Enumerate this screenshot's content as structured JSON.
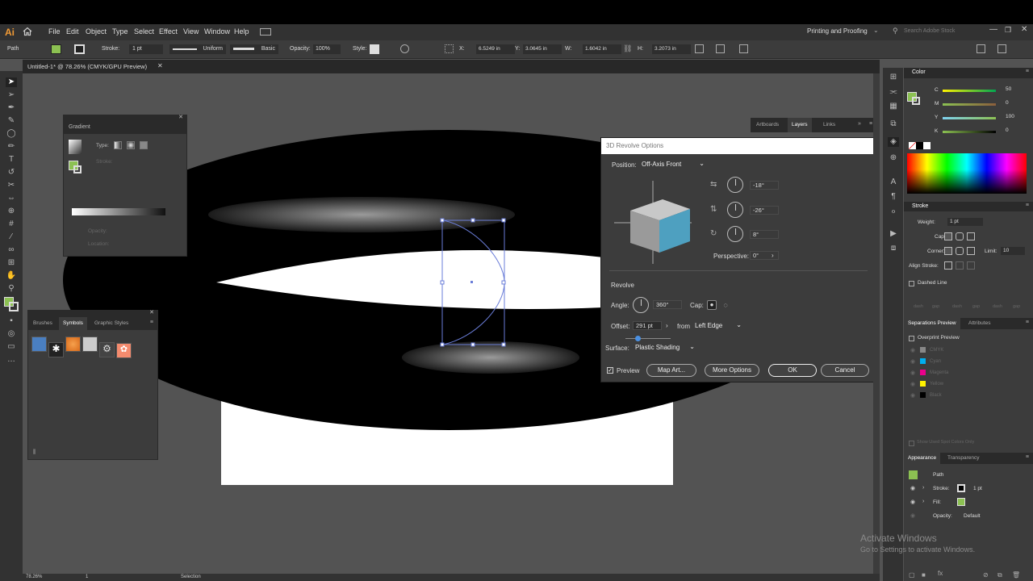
{
  "app_logo": "Ai",
  "menu": [
    "File",
    "Edit",
    "Object",
    "Type",
    "Select",
    "Effect",
    "View",
    "Window",
    "Help"
  ],
  "workspace": "Printing and Proofing",
  "search_placeholder": "Search Adobe Stock",
  "control": {
    "selection_type": "Path",
    "stroke_label": "Stroke:",
    "stroke_value": "1 pt",
    "profile": "Uniform",
    "brush": "Basic",
    "opacity_label": "Opacity:",
    "opacity_value": "100%",
    "style_label": "Style:",
    "x_label": "X:",
    "x_value": "6.5249 in",
    "y_label": "Y:",
    "y_value": "3.0645 in",
    "w_label": "W:",
    "w_value": "1.6042 in",
    "h_label": "H:",
    "h_value": "3.2073 in"
  },
  "doc_tab": "Untitled-1* @ 78.26% (CMYK/GPU Preview)",
  "gradient_panel": {
    "title": "Gradient",
    "type_label": "Type:",
    "stroke_label": "Stroke:",
    "opacity_label": "Opacity:",
    "location_label": "Location:"
  },
  "symbols_panel": {
    "tabs": [
      "Brushes",
      "Symbols",
      "Graphic Styles"
    ],
    "active": "Symbols"
  },
  "dialog": {
    "title": "3D Revolve Options",
    "position_label": "Position:",
    "position_value": "Off-Axis Front",
    "rot_x": "-18°",
    "rot_y": "-26°",
    "rot_z": "8°",
    "perspective_label": "Perspective:",
    "perspective_value": "0°",
    "revolve_heading": "Revolve",
    "angle_label": "Angle:",
    "angle_value": "360°",
    "cap_label": "Cap:",
    "offset_label": "Offset:",
    "offset_value": "291 pt",
    "from_label": "from",
    "from_value": "Left Edge",
    "surface_label": "Surface:",
    "surface_value": "Plastic Shading",
    "preview_label": "Preview",
    "map_art": "Map Art...",
    "more_options": "More Options",
    "ok": "OK",
    "cancel": "Cancel"
  },
  "layers_tabs": [
    "Artboards",
    "Layers",
    "Links"
  ],
  "color_panel": {
    "title": "Color",
    "channels": [
      {
        "name": "C",
        "value": "50",
        "color": "#00aeef"
      },
      {
        "name": "M",
        "value": "0",
        "color": "#ec008c"
      },
      {
        "name": "Y",
        "value": "100",
        "color": "#fff200"
      },
      {
        "name": "K",
        "value": "0",
        "color": "#000000"
      }
    ]
  },
  "stroke_panel": {
    "title": "Stroke",
    "weight_label": "Weight:",
    "weight_value": "1 pt",
    "cap_label": "Cap:",
    "corner_label": "Corner:",
    "limit_label": "Limit:",
    "limit_value": "10",
    "align_label": "Align Stroke:",
    "dashed_label": "Dashed Line",
    "dash_labels": [
      "dash",
      "gap",
      "dash",
      "gap",
      "dash",
      "gap"
    ]
  },
  "separations": {
    "tabs": [
      "Separations Preview",
      "Attributes"
    ],
    "overprint": "Overprint Preview",
    "inks": [
      {
        "name": "CMYK",
        "color": "#888888"
      },
      {
        "name": "Cyan",
        "color": "#00aeef"
      },
      {
        "name": "Magenta",
        "color": "#ec008c"
      },
      {
        "name": "Yellow",
        "color": "#fff200"
      },
      {
        "name": "Black",
        "color": "#000000"
      }
    ],
    "spot_label": "Show Used Spot Colors Only"
  },
  "appearance": {
    "tabs": [
      "Appearance",
      "Transparency"
    ],
    "path": "Path",
    "stroke_label": "Stroke:",
    "stroke_value": "1 pt",
    "fill_label": "Fill:",
    "opacity_label": "Opacity:",
    "opacity_value": "Default"
  },
  "status": {
    "zoom": "78.26%",
    "page": "1",
    "tool": "Selection"
  },
  "watermark": {
    "title": "Activate Windows",
    "sub": "Go to Settings to activate Windows."
  },
  "accent": "#8cc152"
}
